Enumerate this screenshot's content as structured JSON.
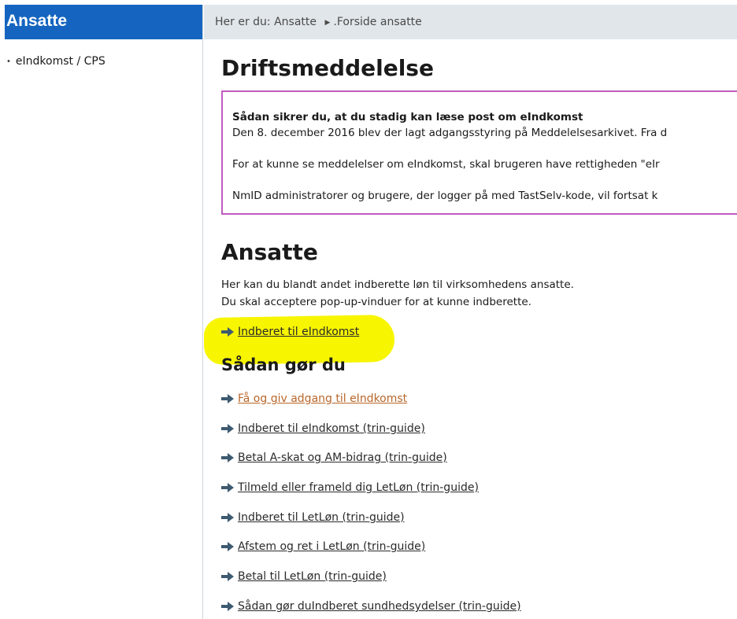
{
  "sidebar": {
    "title": "Ansatte",
    "items": [
      {
        "label": "eIndkomst / CPS"
      }
    ]
  },
  "breadcrumb": {
    "prefix": "Her er du:",
    "items": [
      "Ansatte",
      ".Forside ansatte"
    ]
  },
  "notice": {
    "heading": "Driftsmeddelelse",
    "title": "Sådan sikrer du, at du stadig kan læse post om eIndkomst",
    "lines": [
      "Den 8. december 2016 blev der lagt adgangsstyring på Meddelelsesarkivet. Fra d",
      "For at kunne se meddelelser om eIndkomst, skal brugeren have rettigheden \"eIr",
      "NmID administratorer og brugere, der logger på med TastSelv-kode, vil fortsat k"
    ]
  },
  "section": {
    "heading": "Ansatte",
    "intro_lines": [
      "Her kan du blandt andet indberette løn til virksomhedens ansatte.",
      "Du skal acceptere pop-up-vinduer for at kunne indberette."
    ],
    "primary_link": "Indberet til eIndkomst"
  },
  "howto": {
    "heading": "Sådan gør du",
    "links": [
      {
        "label": "Få og giv adgang til eIndkomst"
      },
      {
        "label": "Indberet til eIndkomst (trin-guide)"
      },
      {
        "label": "Betal A-skat og AM-bidrag (trin-guide)"
      },
      {
        "label": "Tilmeld eller frameld dig LetLøn (trin-guide)"
      },
      {
        "label": "Indberet til LetLøn (trin-guide)"
      },
      {
        "label": "Afstem og ret i LetLøn (trin-guide)"
      },
      {
        "label": "Betal til LetLøn (trin-guide)"
      },
      {
        "label": "Sådan gør duIndberet sundhedsydelser (trin-guide)"
      }
    ]
  },
  "colors": {
    "sidebar_header": "#1565c0",
    "breadcrumb_bg": "#e1e6ea",
    "notice_border": "#c05cc0",
    "highlight": "#f7f500",
    "arrow": "#3d5a70",
    "visited_link": "#b8672a"
  },
  "icons": {
    "link_arrow": "right-arrow-icon",
    "breadcrumb_separator": "triangle-right-icon",
    "sidebar_bullet": "bullet-icon"
  }
}
